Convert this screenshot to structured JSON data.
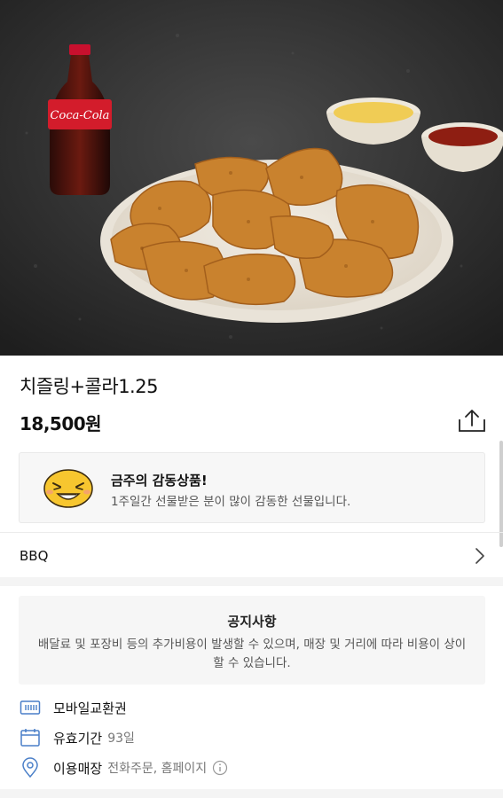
{
  "product": {
    "name": "치즐링+콜라1.25",
    "price": "18,500원",
    "image_bottle_label": "Coca-Cola"
  },
  "promo": {
    "title": "금주의 감동상품!",
    "description": "1주일간 선물받은 분이 많이 감동한 선물입니다."
  },
  "brand": {
    "name": "BBQ"
  },
  "notice": {
    "title": "공지사항",
    "body": "배달료 및 포장비 등의 추가비용이 발생할 수 있으며, 매장 및 거리에 따라 비용이 상이할 수 있습니다."
  },
  "details": {
    "type_label": "모바일교환권",
    "validity_label": "유효기간",
    "validity_value": "93일",
    "store_label": "이용매장",
    "store_value": "전화주문, 홈페이지"
  },
  "colors": {
    "accent_icon": "#4a7fc8",
    "hero_bg": "#2d2d2d"
  },
  "icons": [
    "share-icon",
    "emoji-face-icon",
    "chevron-right-icon",
    "voucher-icon",
    "calendar-icon",
    "location-pin-icon",
    "info-icon"
  ]
}
